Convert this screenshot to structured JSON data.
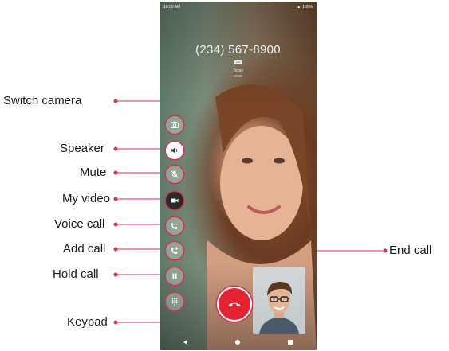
{
  "status_bar": {
    "time": "10:00 AM",
    "battery": "100%"
  },
  "call": {
    "phone_number": "(234) 567-8900",
    "location": "Texas",
    "duration": "00:33",
    "hd_badge": "HD"
  },
  "controls": [
    {
      "id": "switch-camera",
      "label": "Switch camera",
      "icon": "switch-camera-icon"
    },
    {
      "id": "speaker",
      "label": "Speaker",
      "icon": "speaker-icon"
    },
    {
      "id": "mute",
      "label": "Mute",
      "icon": "mute-icon"
    },
    {
      "id": "my-video",
      "label": "My video",
      "icon": "video-camera-icon"
    },
    {
      "id": "voice-call",
      "label": "Voice call",
      "icon": "voice-call-icon"
    },
    {
      "id": "add-call",
      "label": "Add call",
      "icon": "add-call-icon"
    },
    {
      "id": "hold-call",
      "label": "Hold call",
      "icon": "pause-icon"
    },
    {
      "id": "keypad",
      "label": "Keypad",
      "icon": "keypad-icon"
    }
  ],
  "end_call": {
    "label": "End call",
    "icon": "end-call-icon"
  },
  "colors": {
    "accent": "#d5314f",
    "end_call": "#e52332"
  }
}
